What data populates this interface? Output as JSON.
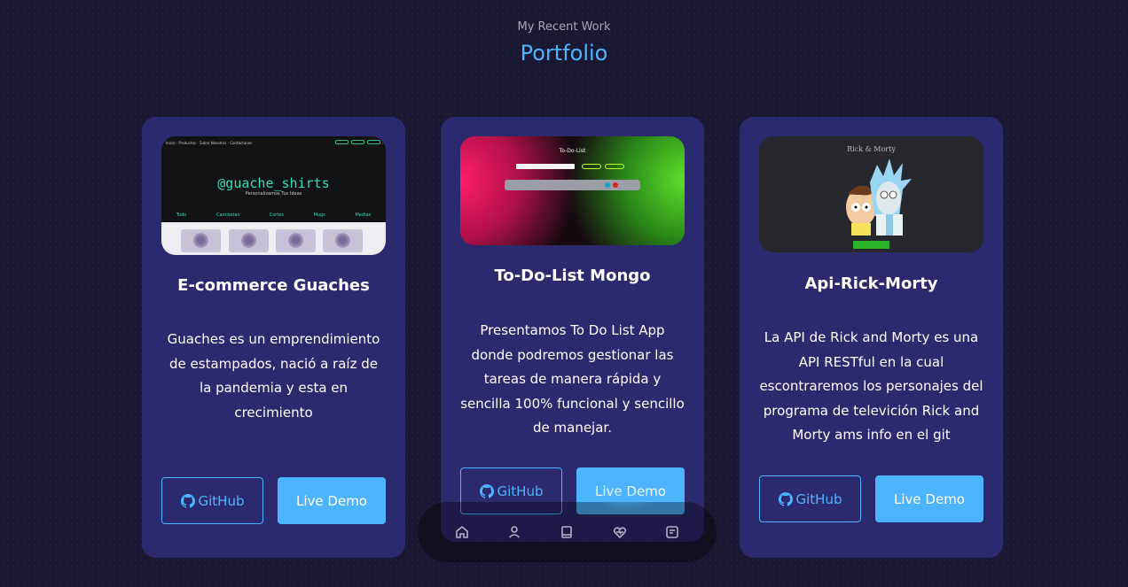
{
  "header": {
    "subtitle": "My Recent Work",
    "title": "Portfolio"
  },
  "projects": [
    {
      "title": "E-commerce Guaches",
      "description": "Guaches es un emprendimiento de estampados, nació a raíz de la pandemia y esta en crecimiento",
      "github_label": "GitHub",
      "demo_label": "Live Demo",
      "screenshot": {
        "brand": "@guache_shirts",
        "tagline": "Personalizamos Tus Ideas",
        "categories": [
          "Todo",
          "Camisetas",
          "Cortes",
          "Mugs",
          "Medias"
        ]
      }
    },
    {
      "title": "To-Do-List Mongo",
      "description": "Presentamos To Do List App donde podremos gestionar las tareas de manera rápida y sencilla 100% funcional y sencillo de manejar.",
      "github_label": "GitHub",
      "demo_label": "Live Demo",
      "screenshot": {
        "heading": "To-Do-List"
      }
    },
    {
      "title": "Api-Rick-Morty",
      "description": "La API de Rick and Morty es una API RESTful en la cual escontraremos los personajes del programa de televición Rick and Morty ams info en el git",
      "github_label": "GitHub",
      "demo_label": "Live Demo",
      "screenshot": {
        "heading": "Rick & Morty"
      }
    }
  ],
  "bottom_nav": {
    "items": [
      "home-icon",
      "user-icon",
      "book-icon",
      "heart-icon",
      "message-icon"
    ],
    "active_glow_color": "#4db5ff"
  },
  "colors": {
    "background": "#191832",
    "card": "#2c2a6e",
    "accent": "#4db5ff"
  }
}
